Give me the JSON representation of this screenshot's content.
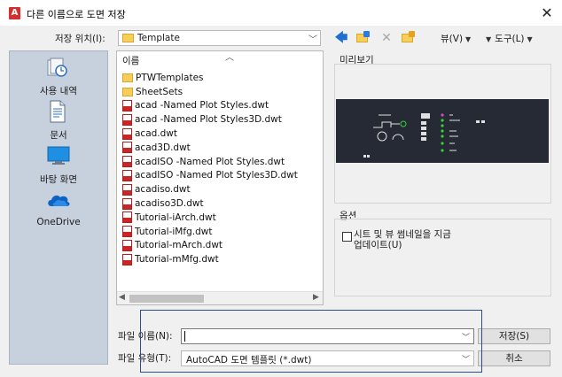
{
  "window": {
    "logo_letter": "A",
    "title": "다른 이름으로 도면 저장",
    "close_glyph": "✕"
  },
  "toolbar": {
    "save_in_label": "저장 위치(I):",
    "save_in_value": "Template",
    "views_label": "뷰(V)",
    "tools_label": "도구(L)",
    "icons": [
      "back-icon",
      "up-folder-icon",
      "delete-icon",
      "new-folder-icon"
    ]
  },
  "places": [
    {
      "label": "사용 내역",
      "icon": "history-icon"
    },
    {
      "label": "문서",
      "icon": "documents-icon"
    },
    {
      "label": "바탕 화면",
      "icon": "desktop-icon"
    },
    {
      "label": "OneDrive",
      "icon": "onedrive-icon"
    }
  ],
  "file_list": {
    "column_name": "이름",
    "items": [
      {
        "name": "PTWTemplates",
        "type": "folder"
      },
      {
        "name": "SheetSets",
        "type": "folder"
      },
      {
        "name": "acad -Named Plot Styles.dwt",
        "type": "dwt"
      },
      {
        "name": "acad -Named Plot Styles3D.dwt",
        "type": "dwt"
      },
      {
        "name": "acad.dwt",
        "type": "dwt"
      },
      {
        "name": "acad3D.dwt",
        "type": "dwt"
      },
      {
        "name": "acadISO -Named Plot Styles.dwt",
        "type": "dwt"
      },
      {
        "name": "acadISO -Named Plot Styles3D.dwt",
        "type": "dwt"
      },
      {
        "name": "acadiso.dwt",
        "type": "dwt"
      },
      {
        "name": "acadiso3D.dwt",
        "type": "dwt"
      },
      {
        "name": "Tutorial-iArch.dwt",
        "type": "dwt"
      },
      {
        "name": "Tutorial-iMfg.dwt",
        "type": "dwt"
      },
      {
        "name": "Tutorial-mArch.dwt",
        "type": "dwt"
      },
      {
        "name": "Tutorial-mMfg.dwt",
        "type": "dwt"
      }
    ]
  },
  "preview": {
    "label": "미리보기"
  },
  "options": {
    "label": "옵션",
    "update_thumbnail_label": "시트 및 뷰 썸네일을 지금 업데이트(U)",
    "update_thumbnail_checked": false
  },
  "filename": {
    "label": "파일 이름(N):",
    "value": ""
  },
  "filetype": {
    "label": "파일 유형(T):",
    "value": "AutoCAD 도면 템플릿 (*.dwt)"
  },
  "buttons": {
    "save": "저장(S)",
    "cancel": "취소"
  },
  "colors": {
    "places_bg": "#c7d0dd",
    "preview_bg": "#252a34",
    "focus_border": "#2a4f82",
    "logo": "#d42f2f"
  }
}
